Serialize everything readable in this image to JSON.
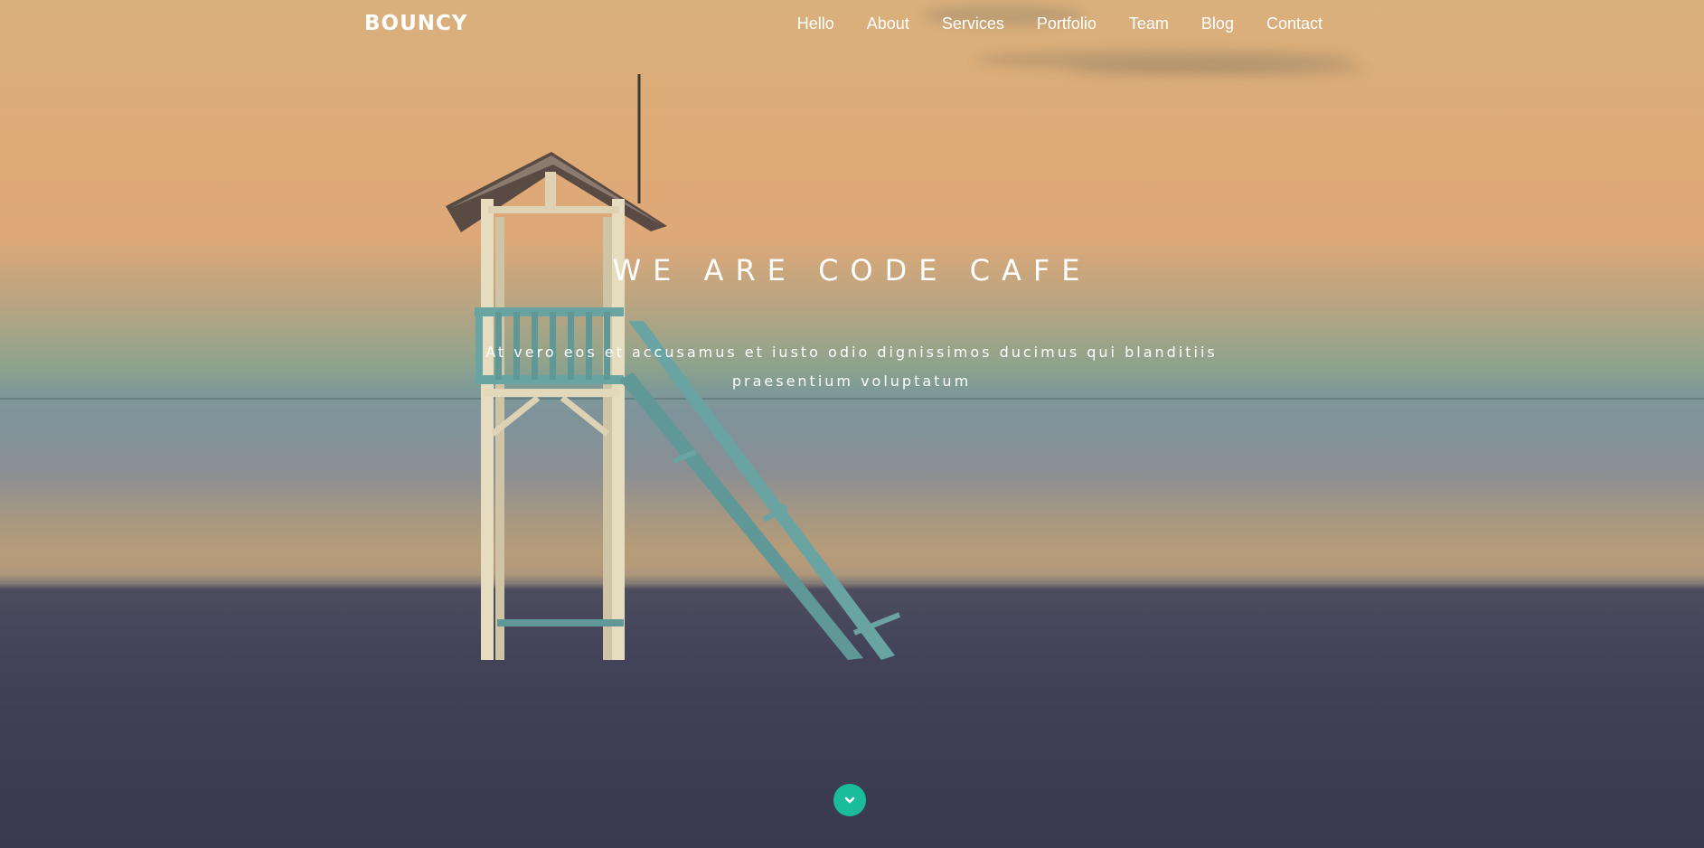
{
  "brand": "BOUNCY",
  "nav": {
    "items": [
      "Hello",
      "About",
      "Services",
      "Portfolio",
      "Team",
      "Blog",
      "Contact"
    ]
  },
  "hero": {
    "headline": "WE ARE CODE CAFE",
    "subtext": "At vero eos et accusamus et iusto odio dignissimos ducimus qui blanditiis praesentium voluptatum"
  },
  "scroll_button": {
    "icon": "chevron-down-icon",
    "color": "#1abc9c"
  },
  "colors": {
    "accent": "#1abc9c",
    "text": "#ffffff"
  }
}
